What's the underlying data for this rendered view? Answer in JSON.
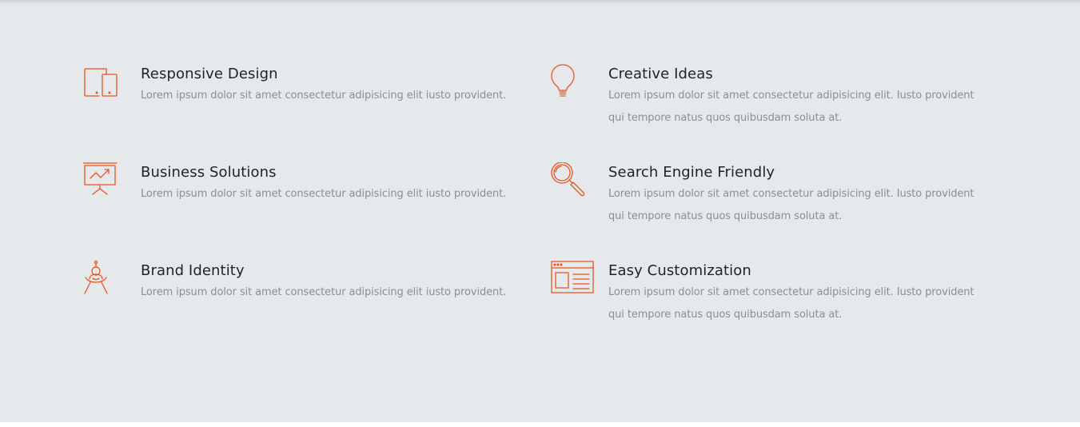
{
  "accent_color": "#e8541e",
  "features": [
    {
      "icon": "tablet-phone-icon",
      "title": "Responsive Design",
      "description": "Lorem ipsum dolor sit amet consectetur adipisicing elit iusto provident."
    },
    {
      "icon": "lightbulb-icon",
      "title": "Creative Ideas",
      "description": "Lorem ipsum dolor sit amet consectetur adipisicing elit. Iusto provident qui tempore natus quos quibusdam soluta at."
    },
    {
      "icon": "presentation-chart-icon",
      "title": "Business Solutions",
      "description": "Lorem ipsum dolor sit amet consectetur adipisicing elit iusto provident."
    },
    {
      "icon": "magnifier-icon",
      "title": "Search Engine Friendly",
      "description": "Lorem ipsum dolor sit amet consectetur adipisicing elit. Iusto provident qui tempore natus quos quibusdam soluta at."
    },
    {
      "icon": "astronaut-icon",
      "title": "Brand Identity",
      "description": "Lorem ipsum dolor sit amet consectetur adipisicing elit iusto provident."
    },
    {
      "icon": "browser-window-icon",
      "title": "Easy Customization",
      "description": "Lorem ipsum dolor sit amet consectetur adipisicing elit. Iusto provident qui tempore natus quos quibusdam soluta at."
    }
  ]
}
